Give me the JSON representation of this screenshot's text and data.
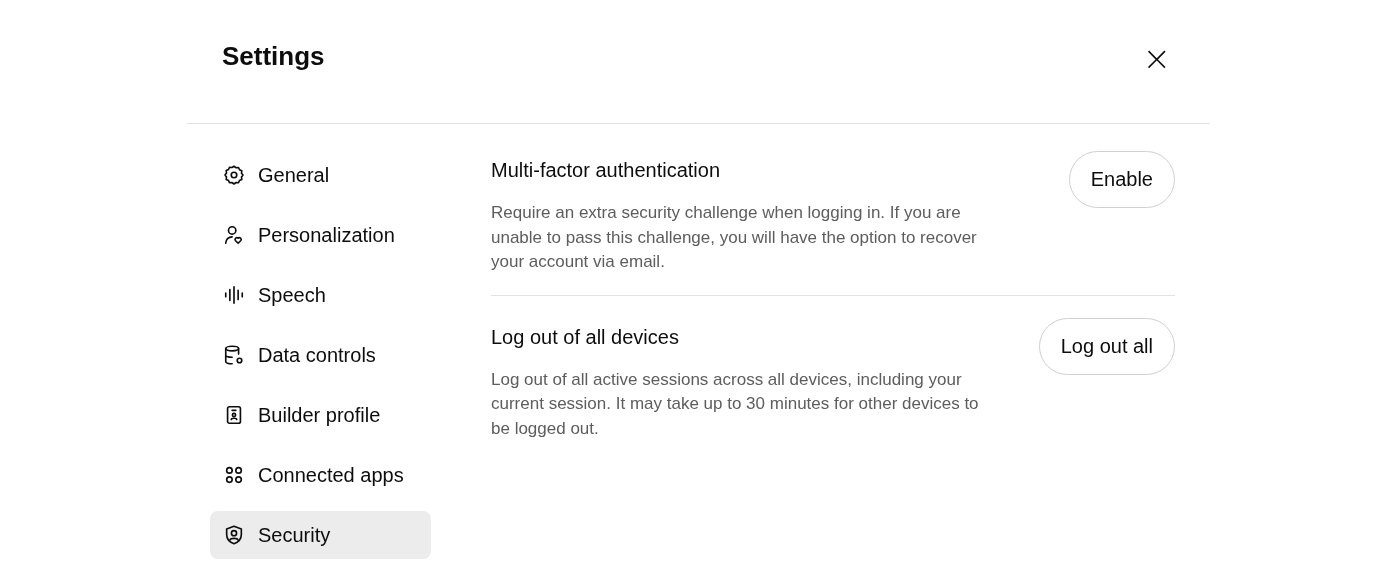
{
  "dialog": {
    "title": "Settings",
    "close": "×"
  },
  "sidebar": {
    "items": [
      {
        "label": "General",
        "kind": "gear",
        "selected": false
      },
      {
        "label": "Personalization",
        "kind": "person",
        "selected": false
      },
      {
        "label": "Speech",
        "kind": "wave",
        "selected": false
      },
      {
        "label": "Data controls",
        "kind": "database",
        "selected": false
      },
      {
        "label": "Builder profile",
        "kind": "badge",
        "selected": false
      },
      {
        "label": "Connected apps",
        "kind": "apps",
        "selected": false
      },
      {
        "label": "Security",
        "kind": "shield",
        "selected": true
      }
    ]
  },
  "sections": [
    {
      "title": "Multi-factor authentication",
      "description": "Require an extra security challenge when logging in. If you are unable to pass this challenge, you will have the option to recover your account via email.",
      "button": "Enable"
    },
    {
      "title": "Log out of all devices",
      "description": "Log out of all active sessions across all devices, including your current session. It may take up to 30 minutes for other devices to be logged out.",
      "button": "Log out all"
    }
  ]
}
